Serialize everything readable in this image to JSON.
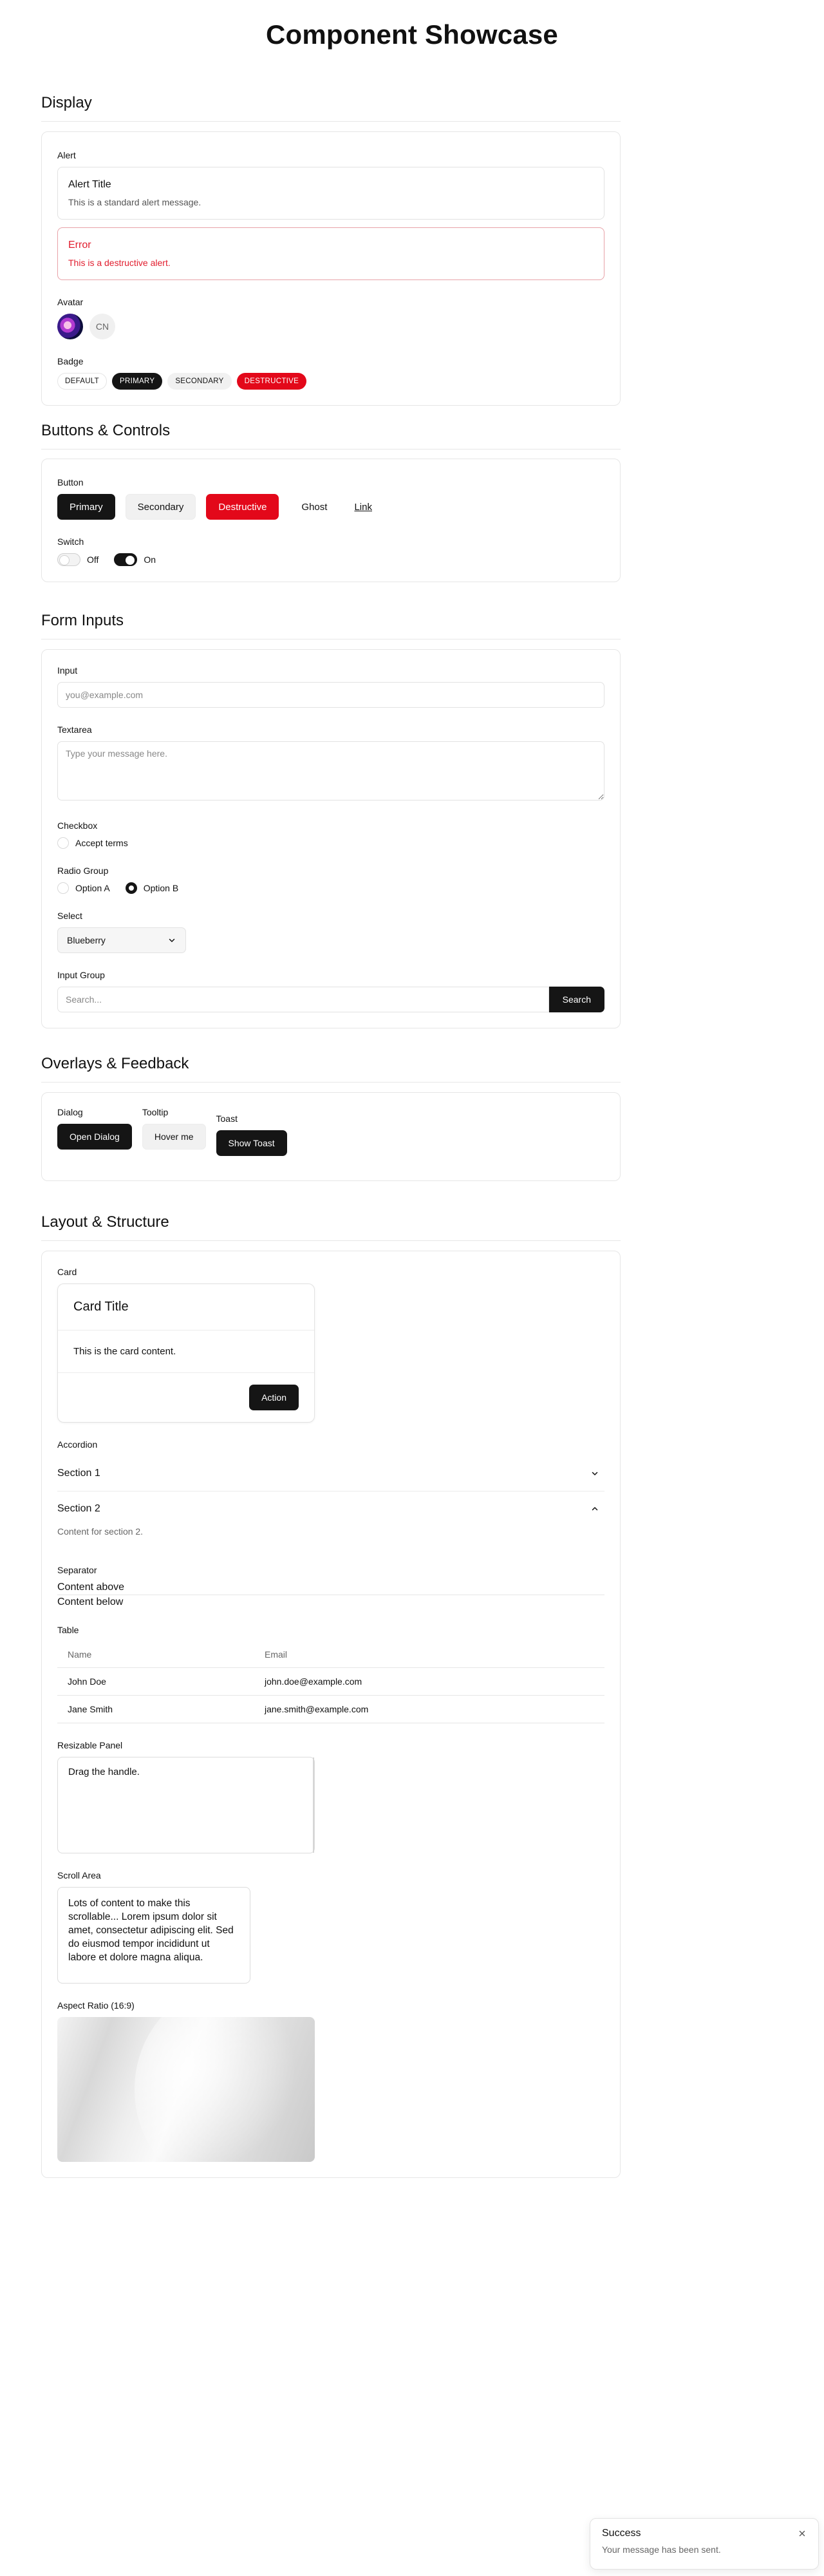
{
  "page": {
    "title": "Component Showcase"
  },
  "sections": {
    "display": "Display",
    "buttons_controls": "Buttons & Controls",
    "form_inputs": "Form Inputs",
    "overlays": "Overlays & Feedback",
    "layout": "Layout & Structure"
  },
  "display": {
    "alert_label": "Alert",
    "alert": {
      "title": "Alert Title",
      "description": "This is a standard alert message."
    },
    "alert_destructive": {
      "title": "Error",
      "description": "This is a destructive alert."
    },
    "avatar_label": "Avatar",
    "avatar_fallback": "CN",
    "badge_label": "Badge",
    "badges": {
      "default": "DEFAULT",
      "primary": "PRIMARY",
      "secondary": "SECONDARY",
      "destructive": "DESTRUCTIVE"
    }
  },
  "controls": {
    "button_label": "Button",
    "buttons": {
      "primary": "Primary",
      "secondary": "Secondary",
      "destructive": "Destructive",
      "ghost": "Ghost",
      "link": "Link"
    },
    "switch_label": "Switch",
    "switch_off": "Off",
    "switch_on": "On"
  },
  "form": {
    "input_label": "Input",
    "input_placeholder": "you@example.com",
    "textarea_label": "Textarea",
    "textarea_placeholder": "Type your message here.",
    "checkbox_label": "Checkbox",
    "checkbox_text": "Accept terms",
    "radio_label": "Radio Group",
    "radio_a": "Option A",
    "radio_b": "Option B",
    "select_label": "Select",
    "select_value": "Blueberry",
    "input_group_label": "Input Group",
    "input_group_placeholder": "Search...",
    "input_group_button": "Search"
  },
  "overlays": {
    "dialog_label": "Dialog",
    "dialog_button": "Open Dialog",
    "tooltip_label": "Tooltip",
    "tooltip_button": "Hover me",
    "toast_label": "Toast",
    "toast_button": "Show Toast"
  },
  "layout": {
    "card_label": "Card",
    "card": {
      "title": "Card Title",
      "content": "This is the card content.",
      "action": "Action"
    },
    "accordion_label": "Accordion",
    "accordion": {
      "section1": "Section 1",
      "section2": "Section 2",
      "section2_content": "Content for section 2."
    },
    "separator_label": "Separator",
    "separator_above": "Content above",
    "separator_below": "Content below",
    "table_label": "Table",
    "table": {
      "headers": [
        "Name",
        "Email"
      ],
      "rows": [
        [
          "John Doe",
          "john.doe@example.com"
        ],
        [
          "Jane Smith",
          "jane.smith@example.com"
        ]
      ]
    },
    "resizable_label": "Resizable Panel",
    "resizable_text": "Drag the handle.",
    "scroll_label": "Scroll Area",
    "scroll_text": "Lots of content to make this scrollable... Lorem ipsum dolor sit amet, consectetur adipiscing elit. Sed do eiusmod tempor incididunt ut labore et dolore magna aliqua.",
    "aspect_label": "Aspect Ratio (16:9)"
  },
  "toast": {
    "title": "Success",
    "description": "Your message has been sent."
  },
  "icons": {
    "select": "chevron-down-icon",
    "accordion_closed": "chevron-down-icon",
    "accordion_open": "chevron-up-icon",
    "toast_close": "close-icon"
  }
}
